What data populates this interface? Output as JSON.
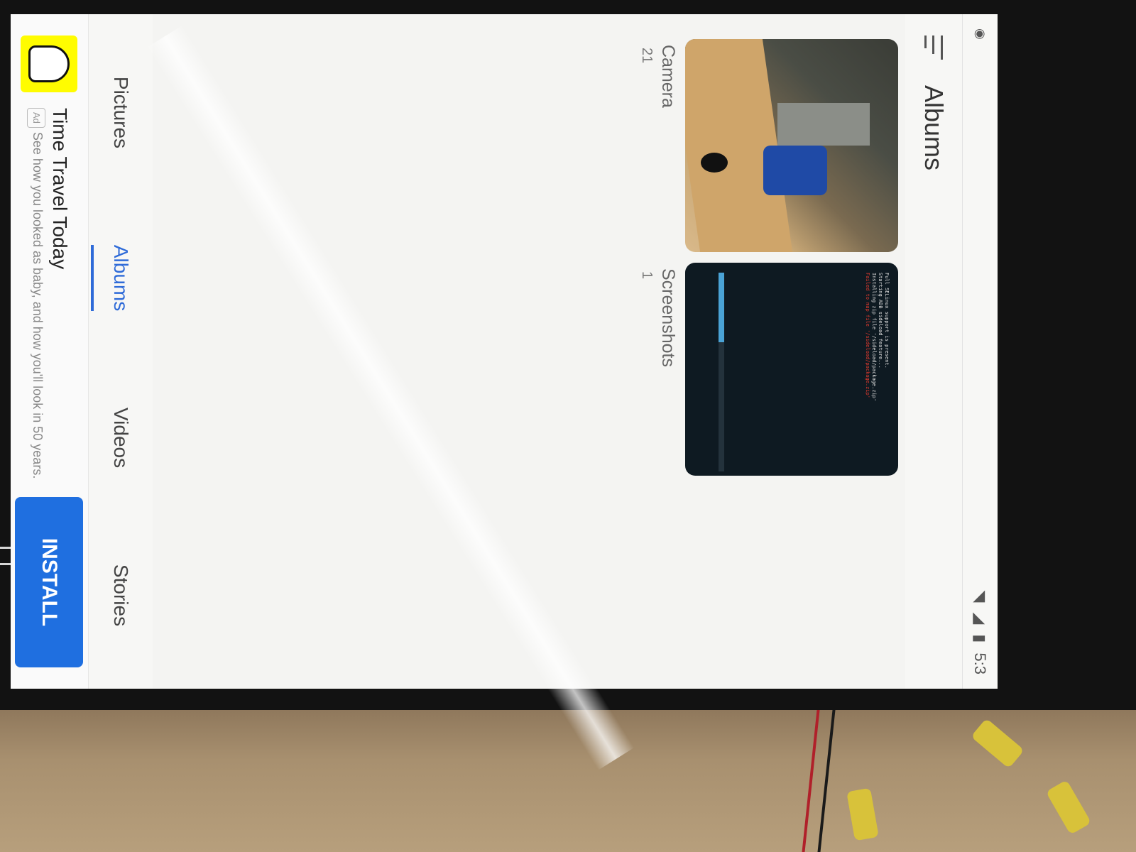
{
  "status_bar": {
    "time": "5:3",
    "icons": [
      "wifi-icon",
      "signal-icon",
      "battery-icon"
    ]
  },
  "app_bar": {
    "title": "Albums",
    "menu_icon": "menu-icon"
  },
  "albums": [
    {
      "name": "Camera",
      "count": "21",
      "thumbnail": "photo-of-office-desk"
    },
    {
      "name": "Screenshots",
      "count": "1",
      "thumbnail": "terminal-screenshot"
    }
  ],
  "screenshot_thumb_text": [
    "Full SELinux support is present.",
    "Starting ADB sideload feature...",
    "Installing zip file '/sideload/package.zip'",
    "Failed to map file '/sideload/package.zip'"
  ],
  "tabs": [
    {
      "label": "Pictures",
      "active": false
    },
    {
      "label": "Albums",
      "active": true
    },
    {
      "label": "Videos",
      "active": false
    },
    {
      "label": "Stories",
      "active": false
    }
  ],
  "ad": {
    "title": "Time Travel Today",
    "badge": "Ad",
    "subtitle": "See how you looked as baby, and how you'll look in 50 years.",
    "cta": "INSTALL"
  },
  "colors": {
    "accent": "#2f6bd8",
    "install_button": "#1f6fe0",
    "snap_yellow": "#fffc00"
  }
}
